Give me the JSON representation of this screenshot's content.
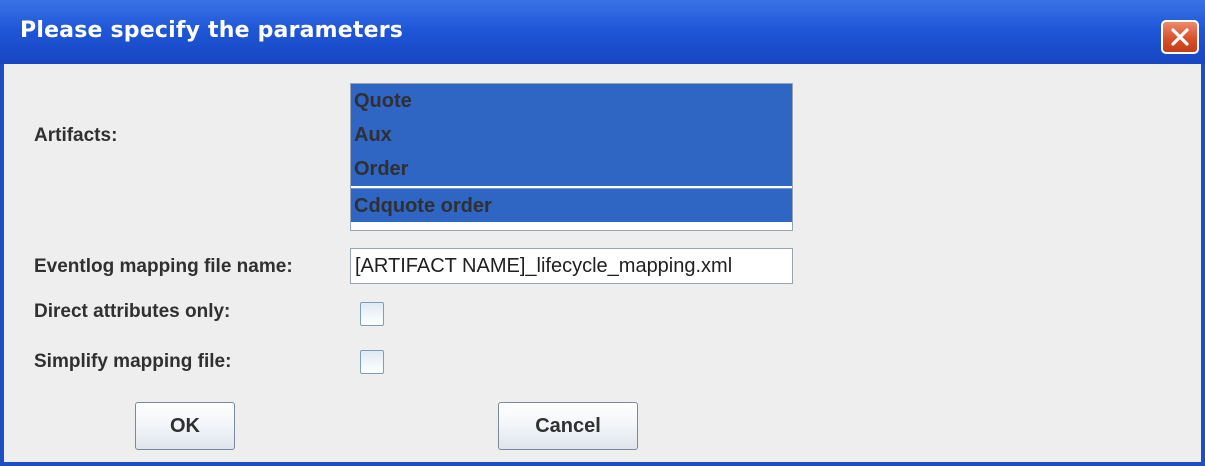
{
  "window": {
    "title": "Please specify the parameters"
  },
  "form": {
    "artifacts_label": "Artifacts:",
    "artifacts": [
      {
        "label": "Quote",
        "selected": true
      },
      {
        "label": "Aux",
        "selected": true
      },
      {
        "label": "Order",
        "selected": true
      },
      {
        "label": "Cdquote order",
        "selected": true
      }
    ],
    "eventlog_label": "Eventlog mapping file name:",
    "eventlog_value": "[ARTIFACT NAME]_lifecycle_mapping.xml",
    "direct_attributes_label": "Direct attributes only:",
    "direct_attributes_checked": false,
    "simplify_label": "Simplify mapping file:",
    "simplify_checked": false
  },
  "buttons": {
    "ok_label": "OK",
    "cancel_label": "Cancel"
  },
  "icons": {
    "close": "close-icon"
  },
  "colors": {
    "titlebar": "#1f57d8",
    "selection": "#2f65c3",
    "close_button": "#d9512b",
    "dialog_background": "#eeeeee"
  }
}
